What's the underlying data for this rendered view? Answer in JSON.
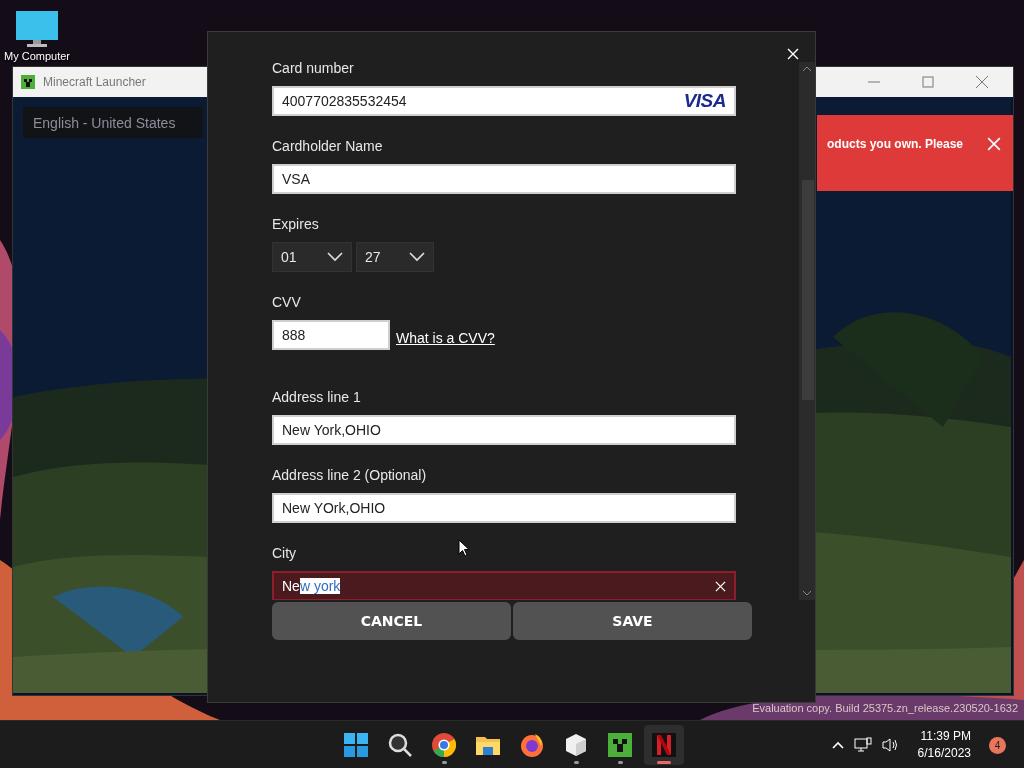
{
  "desktop": {
    "icon_label": "My Computer",
    "watermark": "Evaluation copy. Build 25375.zn_release.230520-1632"
  },
  "launcher": {
    "title": "Minecraft Launcher",
    "language": "English - United States",
    "banner": "oducts you own. Please"
  },
  "dialog": {
    "fields": [
      {
        "kind": "card",
        "label": "Card number",
        "value": "4007702835532454",
        "brand": "VISA"
      },
      {
        "kind": "text",
        "label": "Cardholder Name",
        "value": "VSA"
      },
      {
        "kind": "expiry",
        "label": "Expires",
        "month": "01",
        "year": "27"
      },
      {
        "kind": "cvv",
        "label": "CVV",
        "value": "888",
        "link": "What is a CVV?"
      },
      {
        "kind": "text",
        "label": "Address line 1",
        "value": "New York,OHIO"
      },
      {
        "kind": "text",
        "label": "Address line 2 (Optional)",
        "value": "New YOrk,OHIO"
      },
      {
        "kind": "error",
        "label": "City",
        "value": "Ne",
        "selected_value": "w york"
      }
    ],
    "buttons": [
      {
        "label": "CANCEL"
      },
      {
        "label": "SAVE"
      }
    ]
  },
  "taskbar": {
    "apps": [
      {
        "kind": "start",
        "running": false,
        "active": false
      },
      {
        "kind": "search",
        "running": false,
        "active": false
      },
      {
        "kind": "chrome",
        "running": true,
        "active": false
      },
      {
        "kind": "folder",
        "running": false,
        "active": false
      },
      {
        "kind": "firefox",
        "running": false,
        "active": false
      },
      {
        "kind": "cube",
        "running": true,
        "active": false
      },
      {
        "kind": "creeper",
        "running": true,
        "active": false
      },
      {
        "kind": "netflix",
        "running": true,
        "active": true
      }
    ],
    "time": "11:39 PM",
    "date": "6/16/2023",
    "notifications": "4"
  }
}
